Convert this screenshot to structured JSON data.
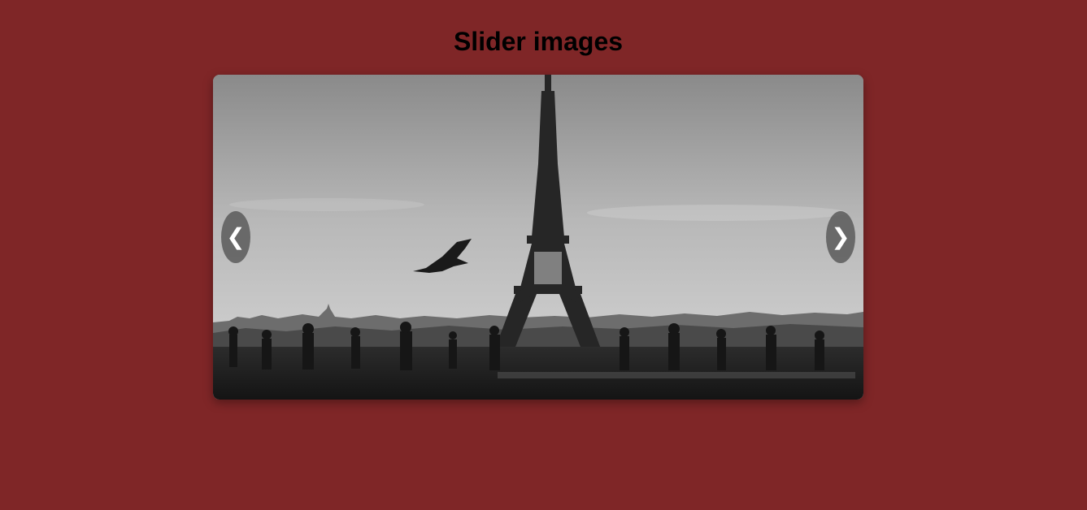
{
  "page": {
    "title": "Slider images"
  },
  "slider": {
    "current_slide": 1,
    "slides": [
      {
        "name": "eiffel-tower-photo"
      }
    ],
    "prev_label": "❮",
    "next_label": "❯"
  },
  "colors": {
    "background": "#7f2627",
    "nav_button": "#5a5a5a",
    "nav_glyph": "#ffffff"
  },
  "icons": {
    "prev": "chevron-left-icon",
    "next": "chevron-right-icon"
  }
}
